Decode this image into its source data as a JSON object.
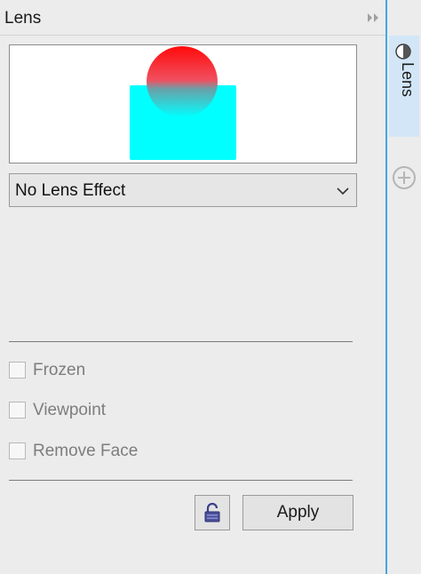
{
  "panel": {
    "title": "Lens"
  },
  "preview": {
    "shapes": {
      "circle_color": "#ff0000",
      "rect_color": "#00ffff"
    }
  },
  "lens_effect": {
    "selected": "No Lens Effect"
  },
  "options": {
    "frozen": {
      "label": "Frozen",
      "checked": false
    },
    "viewpoint": {
      "label": "Viewpoint",
      "checked": false
    },
    "remove_face": {
      "label": "Remove Face",
      "checked": false
    }
  },
  "buttons": {
    "lock_icon": "unlock-icon",
    "apply_label": "Apply"
  },
  "tabs": {
    "lens_label": "Lens",
    "lens_icon": "lens-circle-icon",
    "add_icon": "add-tab-icon"
  },
  "colors": {
    "accent": "#45a6e3",
    "active_tab": "#d2e6f7",
    "background": "#ececec"
  }
}
